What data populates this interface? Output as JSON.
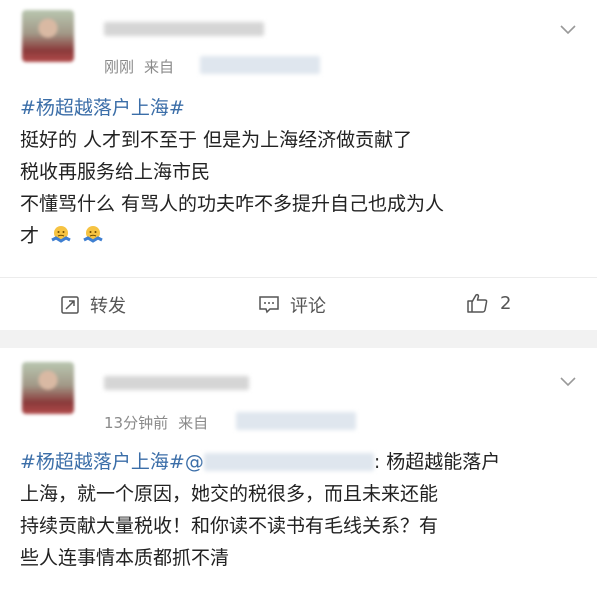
{
  "post1": {
    "time": "刚刚",
    "source_prefix": "来自",
    "lines": [
      {
        "hashtag": "#杨超越落户上海#",
        "text": ""
      },
      {
        "hashtag": "",
        "text": "挺好的 人才到不至于 但是为上海经济做贡献了"
      },
      {
        "hashtag": "",
        "text": "税收再服务给上海市民"
      },
      {
        "hashtag": "",
        "text": "不懂骂什么 有骂人的功夫咋不多提升自己也成为人"
      },
      {
        "hashtag": "",
        "text": "才"
      }
    ],
    "actions": {
      "repost": "转发",
      "comment": "评论",
      "like_count": "2"
    }
  },
  "post2": {
    "time": "13分钟前",
    "source_prefix": "来自",
    "hashtag": "#杨超越落户上海#",
    "at": "@",
    "after_mention": ": 杨超越能落户",
    "lines": [
      "上海，就一个原因，她交的税很多，而且未来还能",
      "持续贡献大量税收！和你读不读书有毛线关系？有",
      "些人连事情本质都抓不清"
    ]
  },
  "icons": {
    "more": "chevron-down-icon",
    "repost": "repost-icon",
    "comment": "comment-icon",
    "like": "thumbs-up-icon",
    "emoji": "shrug-emoji-icon"
  },
  "colors": {
    "hashtag": "#3b6ea8",
    "meta": "#8a8a8a",
    "divider": "#f2f2f2"
  }
}
